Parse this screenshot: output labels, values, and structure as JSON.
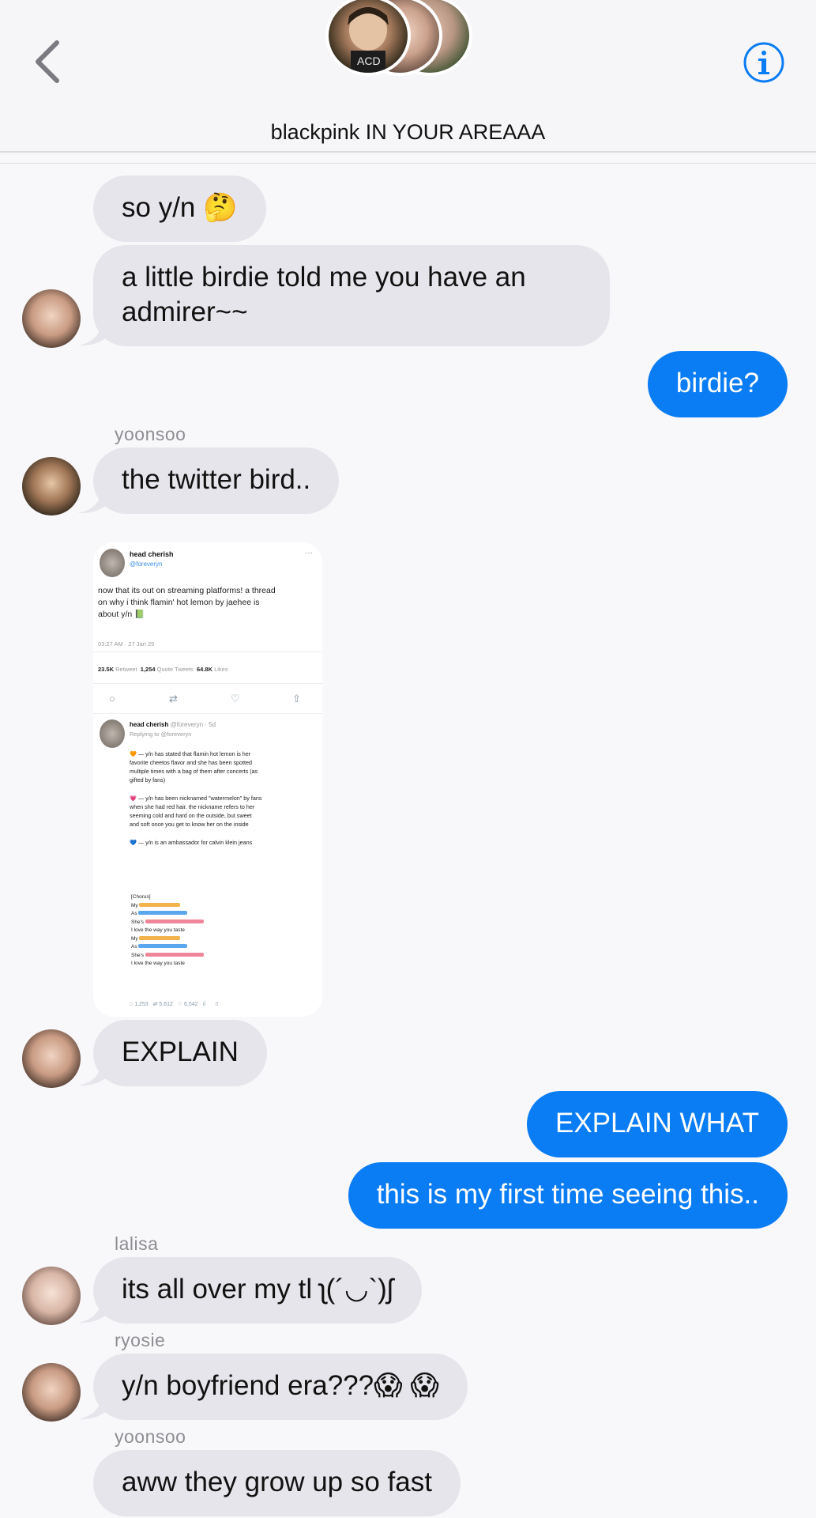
{
  "header": {
    "group_name": "blackpink IN YOUR AREAAA",
    "back_icon": "chevron-left-icon",
    "info_icon": "info-icon",
    "accent": "#0a7cf4"
  },
  "messages": {
    "m1": "so y/n 🤔",
    "m2_line1": "a little birdie told me you have an",
    "m2_line2": "admirer~~",
    "m3": "birdie?",
    "s1": "yoonsoo",
    "m4": "the twitter bird..",
    "m5": "EXPLAIN",
    "m6": "EXPLAIN WHAT",
    "m7": "this is my first time seeing this..",
    "s2": "lalisa",
    "m8": "its all over my tl ʅ(´◡`)ʃ",
    "s3": "ryosie",
    "m9": "y/n boyfriend era???😱 😱",
    "s4": "yoonsoo",
    "m10": "aww they grow up so fast"
  },
  "tweet": {
    "name": "head cherish",
    "handle": "@foreveryn",
    "text1": "now that its out on streaming platforms! a thread",
    "text2": "on why i think flamin' hot lemon by jaehee is",
    "text3": "about y/n 📗",
    "time": "03:27 AM · 27 Jan 25",
    "retweets": "23.5K",
    "retweets_label": "Retweet",
    "quotes": "1,254",
    "quotes_label": "Quote Tweets",
    "likes": "64.8K",
    "likes_label": "Likes",
    "reply_name": "head cherish",
    "reply_handle": "@foreveryn · 5d",
    "replying": "Replying to @foreveryn",
    "p1a": "🧡 — y/n has stated that flamin hot lemon is her",
    "p1b": "favorite cheetos flavor and she has been spotted",
    "p1c": "multiple times with a bag of them after concerts (as",
    "p1d": "gifted by fans)",
    "p2a": "💗 — y/n has been nicknamed \"watermelon\" by fans",
    "p2b": "when she had red hair. the nickname refers to her",
    "p2c": "seeming cold and hard on the outside, but sweet",
    "p2d": "and soft once you get to know her on the inside",
    "p3": "💙 — y/n is an ambassador for calvin klein jeans",
    "lyric_chorus": "[Chorus]",
    "lyric_my": "My",
    "lyric_as": "As",
    "lyric_shes": "She's",
    "lyric_love": "I love the way you taste",
    "f_replies": "1,253",
    "f_rts": "5,612",
    "f_likes": "6,542"
  }
}
